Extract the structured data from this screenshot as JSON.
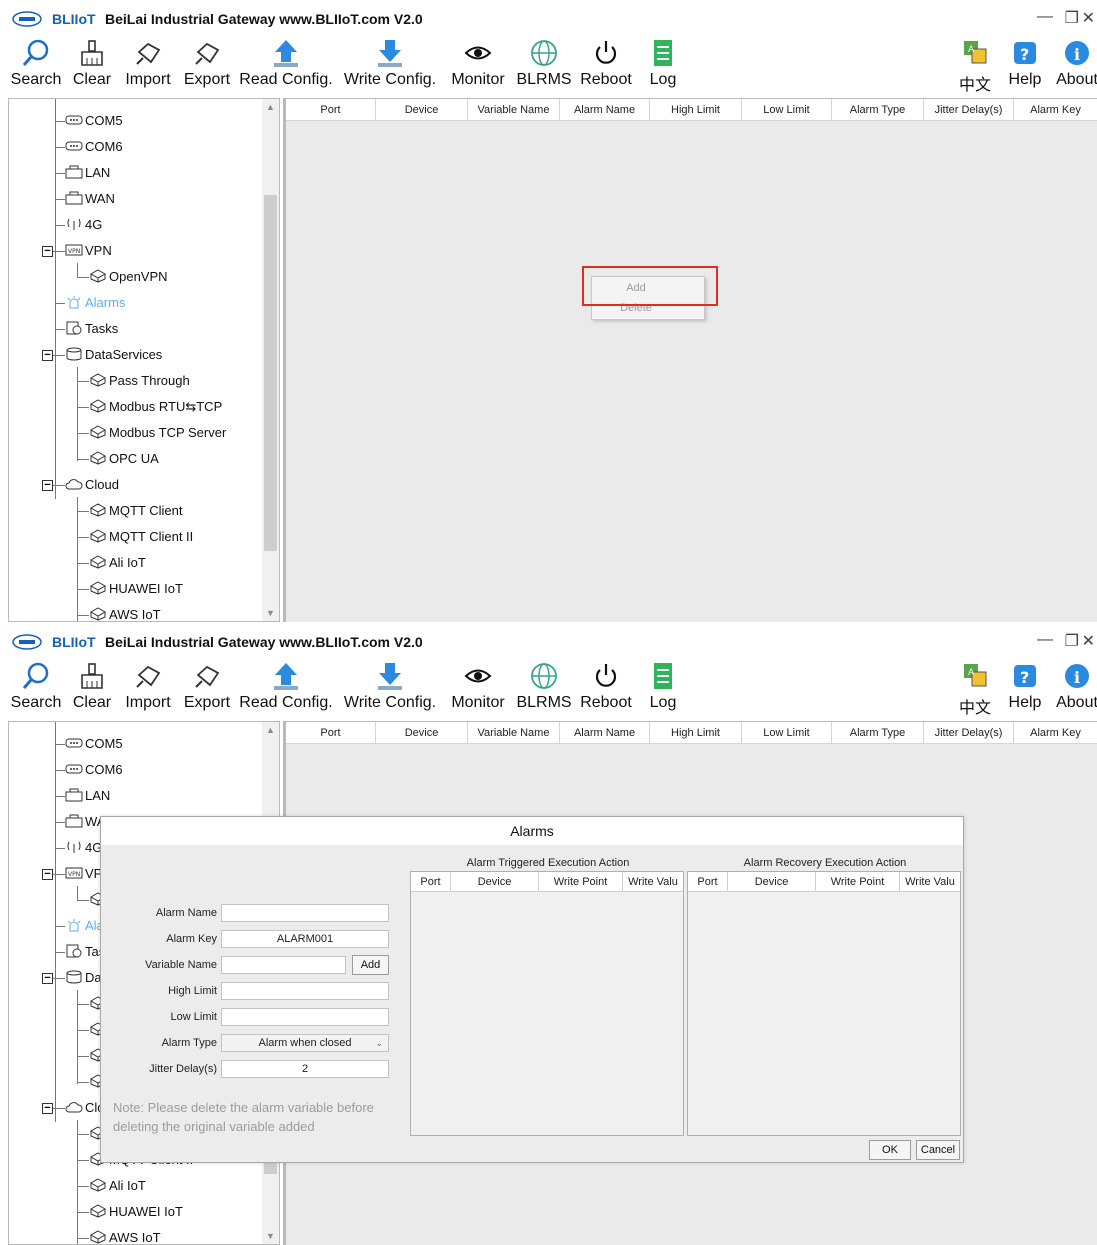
{
  "window": {
    "brand": "BLIIoT",
    "title": "BeiLai Industrial Gateway www.BLIIoT.com V2.0"
  },
  "toolbar": {
    "search": "Search",
    "clear": "Clear",
    "import": "Import",
    "export": "Export",
    "read_config": "Read Config.",
    "write_config": "Write Config.",
    "monitor": "Monitor",
    "blrms": "BLRMS",
    "reboot": "Reboot",
    "log": "Log",
    "language": "中文",
    "help": "Help",
    "about": "About"
  },
  "tree": {
    "com5": "COM5",
    "com6": "COM6",
    "lan": "LAN",
    "wan": "WAN",
    "g4": "4G",
    "vpn": "VPN",
    "openvpn": "OpenVPN",
    "alarms": "Alarms",
    "tasks": "Tasks",
    "dataservices": "DataServices",
    "pass_through": "Pass Through",
    "modbus_rtu_tcp": "Modbus RTU⇆TCP",
    "modbus_tcp_server": "Modbus TCP Server",
    "opc_ua": "OPC UA",
    "cloud": "Cloud",
    "mqtt_client": "MQTT Client",
    "mqtt_client_2": "MQTT Client II",
    "ali_iot": "Ali IoT",
    "huawei_iot": "HUAWEI IoT",
    "aws_iot": "AWS IoT"
  },
  "grid_columns": {
    "port": "Port",
    "device": "Device",
    "variable_name": "Variable Name",
    "alarm_name": "Alarm Name",
    "high_limit": "High Limit",
    "low_limit": "Low Limit",
    "alarm_type": "Alarm Type",
    "jitter_delay": "Jitter Delay(s)",
    "alarm_key": "Alarm Key"
  },
  "context_menu": {
    "add": "Add",
    "delete": "Delete"
  },
  "dialog": {
    "title": "Alarms",
    "alarm_name_label": "Alarm Name",
    "alarm_name_value": "",
    "alarm_key_label": "Alarm Key",
    "alarm_key_value": "ALARM001",
    "variable_name_label": "Variable Name",
    "variable_name_value": "",
    "add_button": "Add",
    "high_limit_label": "High Limit",
    "high_limit_value": "",
    "low_limit_label": "Low Limit",
    "low_limit_value": "",
    "alarm_type_label": "Alarm Type",
    "alarm_type_value": "Alarm when closed",
    "jitter_label": "Jitter Delay(s)",
    "jitter_value": "2",
    "note": "Note: Please delete the alarm variable before deleting the original variable added",
    "triggered_title": "Alarm Triggered Execution Action",
    "recovery_title": "Alarm Recovery Execution Action",
    "action_cols": {
      "port": "Port",
      "device": "Device",
      "write_point": "Write Point",
      "write_value": "Write Valu"
    },
    "ok": "OK",
    "cancel": "Cancel"
  },
  "colors": {
    "brand_blue": "#1560b8",
    "selected_tree_item": "#5eaee8",
    "highlight_red": "#e02c22"
  }
}
